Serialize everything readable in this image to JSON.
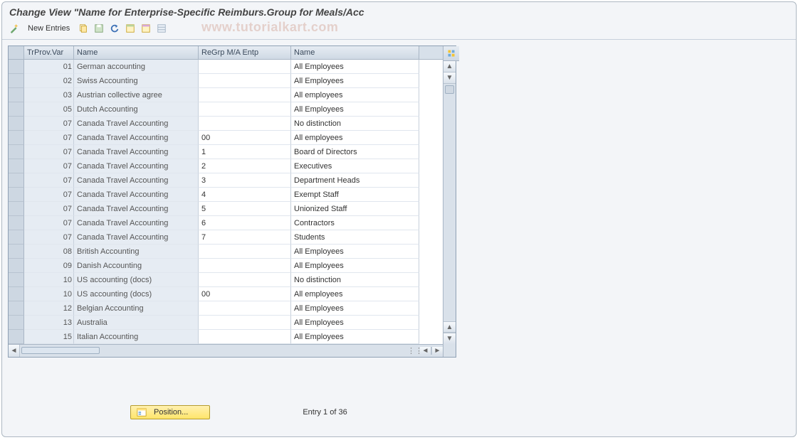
{
  "title": "Change View \"Name for Enterprise-Specific Reimburs.Group for Meals/Acc",
  "watermark": "www.tutorialkart.com",
  "toolbar": {
    "new_entries_label": "New Entries"
  },
  "columns": {
    "trprov_var": "TrProv.Var",
    "name1": "Name",
    "regrp": "ReGrp M/A Entp",
    "name2": "Name"
  },
  "rows": [
    {
      "var": "01",
      "name1": "German accounting",
      "regrp": "",
      "name2": "All Employees"
    },
    {
      "var": "02",
      "name1": "Swiss Accounting",
      "regrp": "",
      "name2": "All Employees"
    },
    {
      "var": "03",
      "name1": "Austrian collective agree",
      "regrp": "",
      "name2": "All employees"
    },
    {
      "var": "05",
      "name1": "Dutch Accounting",
      "regrp": "",
      "name2": "All Employees"
    },
    {
      "var": "07",
      "name1": "Canada Travel Accounting",
      "regrp": "",
      "name2": "No distinction"
    },
    {
      "var": "07",
      "name1": "Canada Travel Accounting",
      "regrp": "00",
      "name2": "All employees"
    },
    {
      "var": "07",
      "name1": "Canada Travel Accounting",
      "regrp": "1",
      "name2": "Board of Directors"
    },
    {
      "var": "07",
      "name1": "Canada Travel Accounting",
      "regrp": "2",
      "name2": "Executives"
    },
    {
      "var": "07",
      "name1": "Canada Travel Accounting",
      "regrp": "3",
      "name2": "Department Heads"
    },
    {
      "var": "07",
      "name1": "Canada Travel Accounting",
      "regrp": "4",
      "name2": "Exempt Staff"
    },
    {
      "var": "07",
      "name1": "Canada Travel Accounting",
      "regrp": "5",
      "name2": "Unionized Staff"
    },
    {
      "var": "07",
      "name1": "Canada Travel Accounting",
      "regrp": "6",
      "name2": "Contractors"
    },
    {
      "var": "07",
      "name1": "Canada Travel Accounting",
      "regrp": "7",
      "name2": "Students"
    },
    {
      "var": "08",
      "name1": "British Accounting",
      "regrp": "",
      "name2": "All Employees"
    },
    {
      "var": "09",
      "name1": "Danish Accounting",
      "regrp": "",
      "name2": "All Employees"
    },
    {
      "var": "10",
      "name1": "US accounting (docs)",
      "regrp": "",
      "name2": "No distinction"
    },
    {
      "var": "10",
      "name1": "US accounting (docs)",
      "regrp": "00",
      "name2": "All employees"
    },
    {
      "var": "12",
      "name1": "Belgian Accounting",
      "regrp": "",
      "name2": "All Employees"
    },
    {
      "var": "13",
      "name1": "Australia",
      "regrp": "",
      "name2": "All Employees"
    },
    {
      "var": "15",
      "name1": "Italian Accounting",
      "regrp": "",
      "name2": "All Employees"
    }
  ],
  "footer": {
    "position_label": "Position...",
    "entry_label": "Entry 1 of 36"
  }
}
